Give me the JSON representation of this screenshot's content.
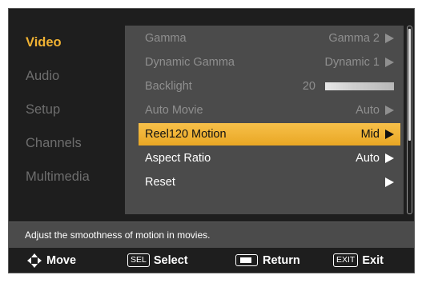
{
  "sidebar": {
    "items": [
      {
        "label": "Video",
        "active": true
      },
      {
        "label": "Audio",
        "active": false
      },
      {
        "label": "Setup",
        "active": false
      },
      {
        "label": "Channels",
        "active": false
      },
      {
        "label": "Multimedia",
        "active": false
      }
    ]
  },
  "menu": {
    "rows": [
      {
        "label": "Gamma",
        "value": "Gamma 2",
        "state": "dim",
        "has_arrow": true
      },
      {
        "label": "Dynamic Gamma",
        "value": "Dynamic 1",
        "state": "dim",
        "has_arrow": true
      },
      {
        "label": "Backlight",
        "value": "20",
        "state": "dim",
        "slider_level": 0.2
      },
      {
        "label": "Auto Movie",
        "value": "Auto",
        "state": "dim",
        "has_arrow": true
      },
      {
        "label": "Reel120 Motion",
        "value": "Mid",
        "state": "selected",
        "has_arrow": true
      },
      {
        "label": "Aspect Ratio",
        "value": "Auto",
        "state": "normal",
        "has_arrow": true
      },
      {
        "label": "Reset",
        "value": "",
        "state": "normal",
        "has_arrow": true
      }
    ]
  },
  "description": "Adjust the smoothness of motion in movies.",
  "footer": {
    "move": "Move",
    "sel_key": "SEL",
    "select": "Select",
    "return": "Return",
    "exit_key": "EXIT",
    "exit": "Exit"
  },
  "colors": {
    "accent": "#f0b233",
    "panel": "#4b4b4b",
    "background": "#1e1e1e"
  }
}
